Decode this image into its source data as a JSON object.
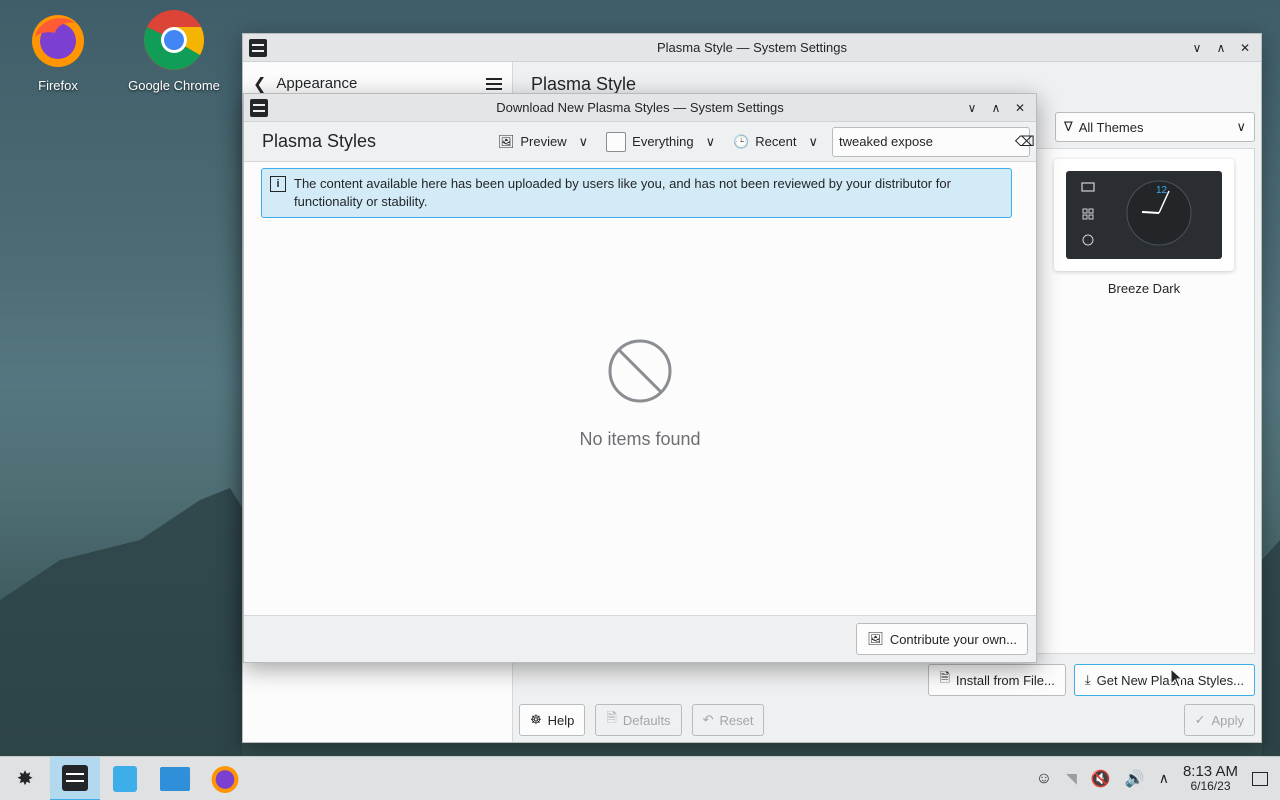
{
  "desktop": {
    "icons": [
      {
        "label": "Firefox"
      },
      {
        "label": "Google Chrome"
      }
    ]
  },
  "main_window": {
    "title": "Plasma Style — System Settings",
    "sidebar_back_label": "Appearance",
    "page_title": "Plasma Style",
    "filter_label": "All Themes",
    "theme_card": {
      "name": "Breeze Dark"
    },
    "install_from_file": "Install from File...",
    "get_new": "Get New Plasma Styles...",
    "help": "Help",
    "defaults": "Defaults",
    "reset": "Reset",
    "apply": "Apply"
  },
  "dialog": {
    "title": "Download New Plasma Styles — System Settings",
    "heading": "Plasma Styles",
    "toolbar": {
      "preview": "Preview",
      "everything": "Everything",
      "recent": "Recent"
    },
    "search_value": "tweaked expose",
    "info_message": "The content available here has been uploaded by users like you, and has not been reviewed by your distributor for functionality or stability.",
    "empty_message": "No items found",
    "contribute": "Contribute your own..."
  },
  "taskbar": {
    "time": "8:13 AM",
    "date": "6/16/23"
  },
  "colors": {
    "accent": "#3daee9",
    "info_bg": "#d3ebf7"
  }
}
